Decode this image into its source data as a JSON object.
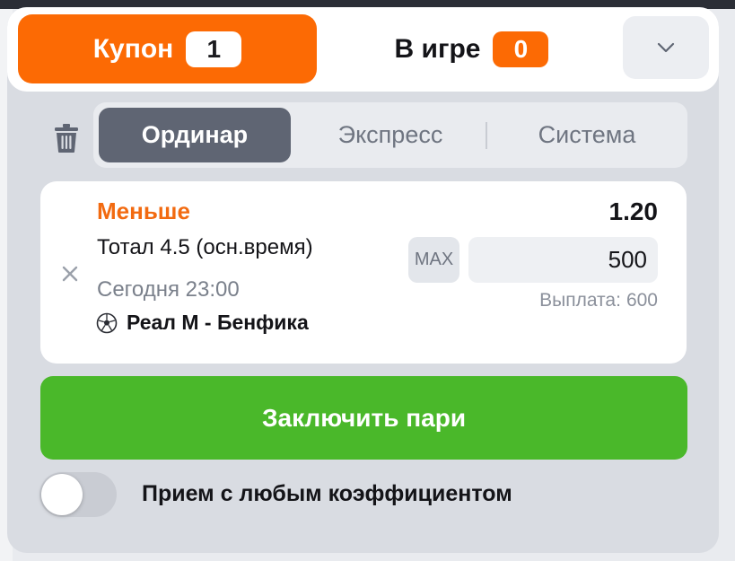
{
  "header": {
    "coupon_tab": {
      "label": "Купон",
      "count": "1"
    },
    "ingame_tab": {
      "label": "В игре",
      "count": "0"
    },
    "collapse_icon": "chevron-down-icon"
  },
  "bet_type": {
    "trash_icon": "trash-icon",
    "options": [
      "Ординар",
      "Экспресс",
      "Система"
    ],
    "selected": "Ординар"
  },
  "bet": {
    "outcome": "Меньше",
    "odds": "1.20",
    "market": "Тотал 4.5 (осн.время)",
    "time": "Сегодня 23:00",
    "sport_icon": "soccer-ball-icon",
    "match": "Реал М - Бенфика",
    "max_label": "MAX",
    "stake": "500",
    "payout_label": "Выплата:",
    "payout_value": "600",
    "remove_icon": "close-icon"
  },
  "place_bet_label": "Заключить пари",
  "any_odds_toggle": {
    "label": "Прием с любым коэффициентом",
    "enabled": false
  },
  "colors": {
    "accent_orange": "#fc6a04",
    "outcome_orange": "#f26a10",
    "action_green": "#4ab82a",
    "selected_segment": "#5f6573"
  }
}
